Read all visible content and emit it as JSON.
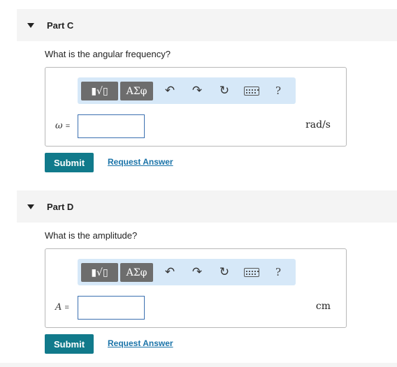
{
  "parts": [
    {
      "title": "Part C",
      "question": "What is the angular frequency?",
      "variable": "ω",
      "equals": "=",
      "unit": "rad/s",
      "input_value": "",
      "submit_label": "Submit",
      "request_label": "Request Answer"
    },
    {
      "title": "Part D",
      "question": "What is the amplitude?",
      "variable": "A",
      "equals": "=",
      "unit": "cm",
      "input_value": "",
      "submit_label": "Submit",
      "request_label": "Request Answer"
    }
  ],
  "toolbar": {
    "templates_label": "▮√▯",
    "symbols_label": "ΑΣφ",
    "undo_icon": "↶",
    "redo_icon": "↷",
    "reset_icon": "↻",
    "keyboard_icon": "keyboard-icon",
    "help_label": "?"
  },
  "colors": {
    "accent": "#117a8b",
    "link": "#1a73a8",
    "toolbar_bg": "#d6e8f8",
    "header_bg": "#f4f4f4"
  }
}
